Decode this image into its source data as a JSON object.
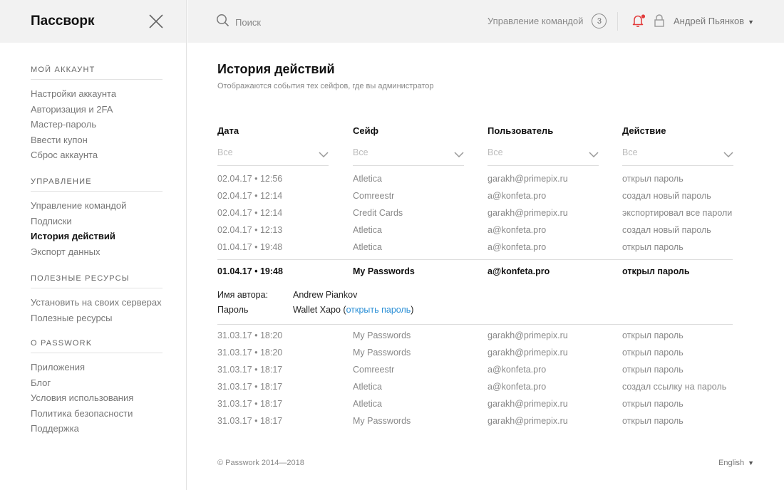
{
  "sidebar": {
    "brand": "Пассворк",
    "sections": [
      {
        "title": "Мой аккаунт",
        "items": [
          "Настройки аккаунта",
          "Авторизация и 2FA",
          "Мастер-пароль",
          "Ввести купон",
          "Сброс аккаунта"
        ]
      },
      {
        "title": "Управление",
        "items": [
          "Управление командой",
          "Подписки",
          "История действий",
          "Экспорт данных"
        ]
      },
      {
        "title": "Полезные ресурсы",
        "items": [
          "Установить на своих серверах",
          "Полезные ресурсы"
        ]
      },
      {
        "title": "О Passwork",
        "items": [
          "Приложения",
          "Блог",
          "Условия использования",
          "Политика безопасности",
          "Поддержка"
        ]
      }
    ],
    "active_item": "История действий"
  },
  "header": {
    "search_placeholder": "Поиск",
    "team_label": "Управление командой",
    "team_count": "3",
    "user_name": "Андрей Пьянков",
    "notification_color": "#e23b3b"
  },
  "main": {
    "title": "История действий",
    "subtitle": "Отображаются события тех сейфов, где вы администратор",
    "columns": [
      "Дата",
      "Сейф",
      "Пользователь",
      "Действие"
    ],
    "filter_placeholder": "Все",
    "rows_before": [
      [
        "02.04.17 • 12:56",
        "Atletica",
        "garakh@primepix.ru",
        "открыл пароль"
      ],
      [
        "02.04.17 • 12:14",
        "Comreestr",
        "a@konfeta.pro",
        "создал новый пароль"
      ],
      [
        "02.04.17 • 12:14",
        "Credit Cards",
        "garakh@primepix.ru",
        "экспортировал все пароли"
      ],
      [
        "02.04.17 • 12:13",
        "Atletica",
        "a@konfeta.pro",
        "создал новый пароль"
      ],
      [
        "01.04.17 • 19:48",
        "Atletica",
        "a@konfeta.pro",
        "открыл пароль"
      ]
    ],
    "expanded": {
      "row": [
        "01.04.17 • 19:48",
        "My Passwords",
        "a@konfeta.pro",
        "открыл пароль"
      ],
      "author_label": "Имя автора:",
      "author_value": "Andrew Piankov",
      "password_label": "Пароль",
      "password_value": "Wallet Xapo",
      "open_link": "открыть пароль"
    },
    "rows_after": [
      [
        "31.03.17 • 18:20",
        "My Passwords",
        "garakh@primepix.ru",
        "открыл пароль"
      ],
      [
        "31.03.17 • 18:20",
        "My Passwords",
        "garakh@primepix.ru",
        "открыл пароль"
      ],
      [
        "31.03.17 • 18:17",
        "Comreestr",
        "a@konfeta.pro",
        "открыл пароль"
      ],
      [
        "31.03.17 • 18:17",
        "Atletica",
        "a@konfeta.pro",
        "создал ссылку на пароль"
      ],
      [
        "31.03.17 • 18:17",
        "Atletica",
        "garakh@primepix.ru",
        "открыл пароль"
      ],
      [
        "31.03.17 • 18:17",
        "My Passwords",
        "garakh@primepix.ru",
        "открыл пароль"
      ]
    ]
  },
  "footer": {
    "copyright": "© Passwork 2014—2018",
    "language": "English"
  }
}
